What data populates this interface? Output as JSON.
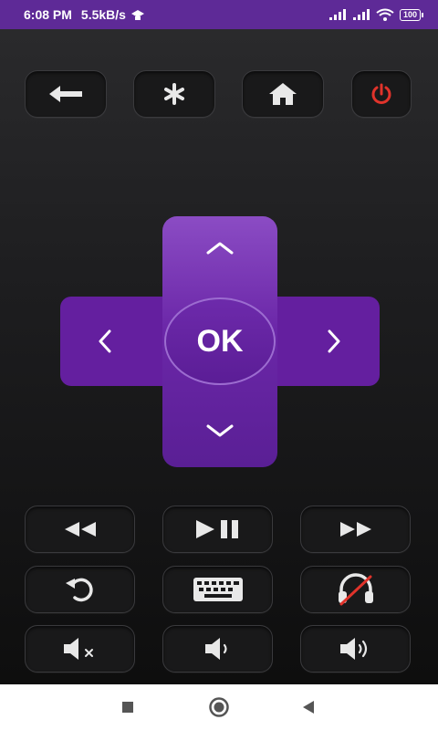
{
  "status_bar": {
    "time": "6:08 PM",
    "net_speed": "5.5kB/s",
    "battery": "100"
  },
  "remote": {
    "top_row": [
      {
        "icon": "back-arrow-icon"
      },
      {
        "icon": "asterisk-icon"
      },
      {
        "icon": "home-icon"
      },
      {
        "icon": "power-icon",
        "color": "#e0332b"
      }
    ],
    "dpad": {
      "ok_label": "OK",
      "color": "#641f9f"
    },
    "media_rows": [
      [
        "rewind-icon",
        "play-pause-icon",
        "fast-forward-icon"
      ],
      [
        "replay-icon",
        "keyboard-icon",
        "headphones-off-icon"
      ],
      [
        "mute-icon",
        "volume-down-icon",
        "volume-up-icon"
      ]
    ]
  },
  "nav_bar": {
    "items": [
      "recents-square-icon",
      "home-circle-icon",
      "back-triangle-icon"
    ]
  }
}
